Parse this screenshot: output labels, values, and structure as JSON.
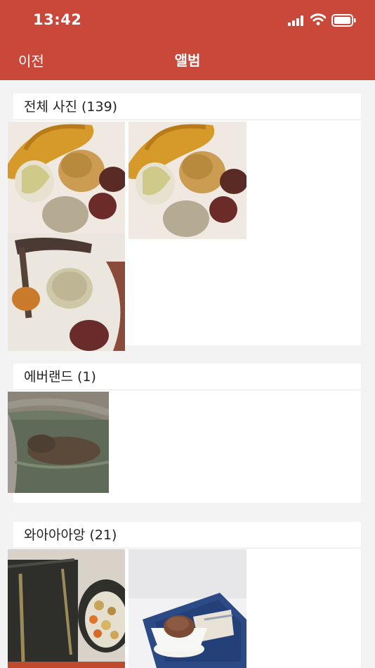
{
  "status": {
    "time": "13:42"
  },
  "nav": {
    "back_label": "이전",
    "title": "앨범"
  },
  "albums": [
    {
      "name": "전체 사진 (139)"
    },
    {
      "name": "에버랜드 (1)"
    },
    {
      "name": "와아아아앙 (21)"
    }
  ],
  "colors": {
    "accent": "#c9483a",
    "background": "#f3f3f3",
    "card": "#ffffff"
  },
  "icons": [
    "cellular-signal-icon",
    "wifi-icon",
    "battery-icon"
  ]
}
